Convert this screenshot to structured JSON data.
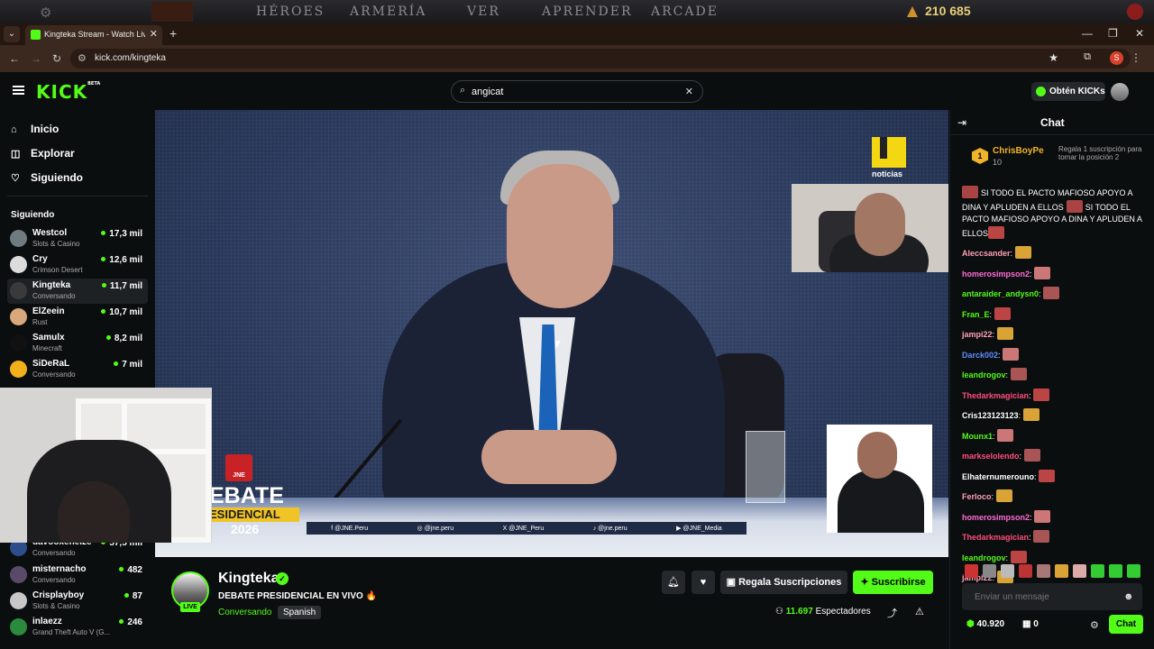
{
  "game_bar": {
    "items": [
      "HÉROES",
      "ARMERÍA",
      "VER",
      "APRENDER",
      "ARCADE"
    ],
    "gold": "210 685"
  },
  "browser": {
    "tab_title": "Kingteka Stream - Watch Live on Kick",
    "url": "kick.com/kingteka",
    "profile_letter": "S"
  },
  "header": {
    "logo": "KICK",
    "logo_badge": "BETA",
    "search_value": "angicat",
    "get_kicks_label": "Obtén KICKs"
  },
  "sidebar": {
    "nav": [
      {
        "label": "Inicio",
        "icon": "home-icon"
      },
      {
        "label": "Explorar",
        "icon": "compass-icon"
      },
      {
        "label": "Siguiendo",
        "icon": "heart-icon"
      }
    ],
    "following_title": "Siguiendo",
    "channels": [
      {
        "name": "Westcol",
        "category": "Slots & Casino",
        "viewers": "17,3 mil",
        "color": "#6f7b7f",
        "active": false
      },
      {
        "name": "Cry",
        "category": "Crimson Desert",
        "viewers": "12,6 mil",
        "color": "#dcdcdc",
        "active": false
      },
      {
        "name": "Kingteka",
        "category": "Conversando",
        "viewers": "11,7 mil",
        "color": "#3a3a3a",
        "active": true
      },
      {
        "name": "ElZeein",
        "category": "Rust",
        "viewers": "10,7 mil",
        "color": "#d9a87b",
        "active": false
      },
      {
        "name": "Samulx",
        "category": "Minecraft",
        "viewers": "8,2 mil",
        "color": "#111111",
        "active": false
      },
      {
        "name": "SiDeRaL",
        "category": "Conversando",
        "viewers": "7 mil",
        "color": "#f2b01a",
        "active": false
      },
      {
        "name": "davooxeneize",
        "category": "Conversando",
        "viewers": "57,5 mil",
        "color": "#2c4c8a",
        "active": false
      },
      {
        "name": "misternacho",
        "category": "Conversando",
        "viewers": "482",
        "color": "#5a4a6a",
        "active": false
      },
      {
        "name": "Crisplayboy",
        "category": "Slots & Casino",
        "viewers": "87",
        "color": "#c7c7c7",
        "active": false
      },
      {
        "name": "inlaezz",
        "category": "Grand Theft Auto V (G...",
        "viewers": "246",
        "color": "#2b8a3e",
        "active": false
      }
    ]
  },
  "video": {
    "news_label": "noticias",
    "banner_line1": "EBATE",
    "banner_line2": "ESIDENCIAL",
    "banner_year": "2026",
    "jne_label": "JNE",
    "socials": [
      "f @JNE.Peru",
      "◎ @jne.peru",
      "X @JNE_Peru",
      "♪ @jne.peru",
      "▶ @JNE_Media"
    ]
  },
  "stream": {
    "channel_name": "Kingteka",
    "live_label": "LIVE",
    "title": "DEBATE PRESIDENCIAL EN VIVO 🔥",
    "category": "Conversando",
    "language": "Spanish",
    "gift_label": "Regala Suscripciones",
    "subscribe_label": "Suscribirse",
    "viewer_count": "11.697",
    "viewer_label": "Espectadores"
  },
  "chat": {
    "title": "Chat",
    "pinned": {
      "rank": "1",
      "user": "ChrisBoyPe",
      "count": "10",
      "text": "Regala 1 suscripción para tomar la posición 2"
    },
    "messages": [
      {
        "user": "",
        "color": "#ffffff",
        "text": "SI TODO EL PACTO MAFIOSO APOYO A DINA Y APLUDEN A ELLOS",
        "text2": "SI TODO EL PACTO MAFIOSO APOYO A DINA Y APLUDEN A ELLOS"
      },
      {
        "user": "Aleccsander",
        "color": "#ff9fb5",
        "text": ""
      },
      {
        "user": "homerosimpson2",
        "color": "#ff6ad5",
        "text": ""
      },
      {
        "user": "antaraider_andysn0",
        "color": "#53fc18",
        "text": ""
      },
      {
        "user": "Fran_E",
        "color": "#53fc18",
        "text": ""
      },
      {
        "user": "jampi22",
        "color": "#ff9fb5",
        "text": ""
      },
      {
        "user": "Darck002",
        "color": "#5d8cff",
        "text": ""
      },
      {
        "user": "leandrogov",
        "color": "#53fc18",
        "text": ""
      },
      {
        "user": "Thedarkmagician",
        "color": "#ff4d7d",
        "text": ""
      },
      {
        "user": "Cris123123123",
        "color": "#ffffff",
        "text": ""
      },
      {
        "user": "Mounx1",
        "color": "#53fc18",
        "text": ""
      },
      {
        "user": "markselolendo",
        "color": "#ff4d7d",
        "text": ""
      },
      {
        "user": "Elhaternumerouno",
        "color": "#ffffff",
        "text": ""
      },
      {
        "user": "Ferloco",
        "color": "#ff9fb5",
        "text": ""
      },
      {
        "user": "homerosimpson2",
        "color": "#ff6ad5",
        "text": ""
      },
      {
        "user": "Thedarkmagician",
        "color": "#ff4d7d",
        "text": ""
      },
      {
        "user": "leandrogov",
        "color": "#53fc18",
        "text": ""
      },
      {
        "user": "jampi22",
        "color": "#ff9fb5",
        "text": ""
      }
    ],
    "input_placeholder": "Enviar un mensaje",
    "points": "40.920",
    "redeems": "0",
    "send_label": "Chat"
  },
  "colors": {
    "accent": "#53fc18",
    "background": "#0b0e0f",
    "panel": "#24272c"
  }
}
